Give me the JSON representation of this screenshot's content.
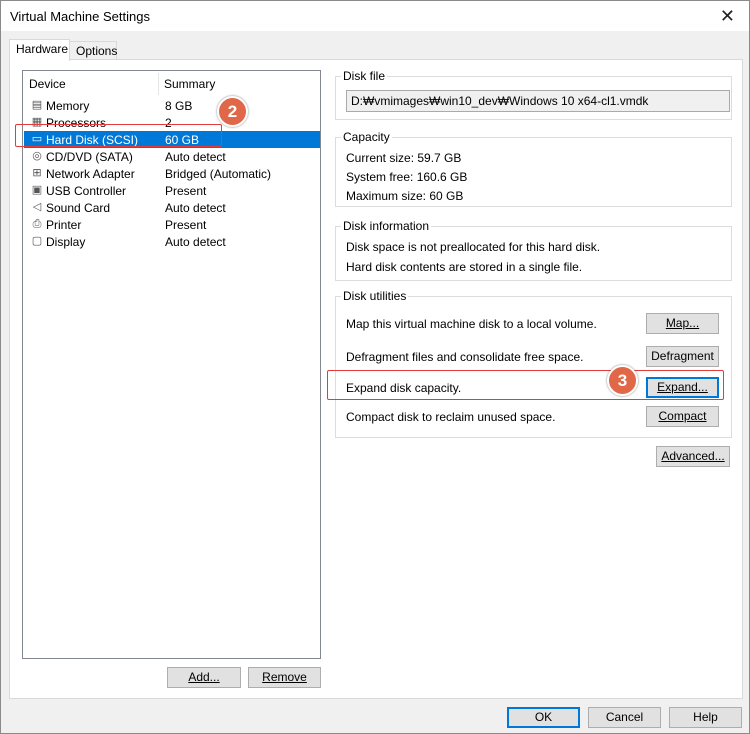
{
  "window": {
    "title": "Virtual Machine Settings",
    "close_glyph": "✕"
  },
  "tabs": [
    {
      "label": "Hardware",
      "active": true
    },
    {
      "label": "Options",
      "active": false
    }
  ],
  "device_list": {
    "col_device": "Device",
    "col_summary": "Summary",
    "rows": [
      {
        "name": "Memory",
        "summary": "8 GB",
        "icon": "memory-icon",
        "glyph": "▤"
      },
      {
        "name": "Processors",
        "summary": "2",
        "icon": "processor-icon",
        "glyph": "▦"
      },
      {
        "name": "Hard Disk (SCSI)",
        "summary": "60 GB",
        "icon": "hard-disk-icon",
        "glyph": "▭",
        "selected": true
      },
      {
        "name": "CD/DVD (SATA)",
        "summary": "Auto detect",
        "icon": "cd-dvd-icon",
        "glyph": "◎"
      },
      {
        "name": "Network Adapter",
        "summary": "Bridged (Automatic)",
        "icon": "network-adapter-icon",
        "glyph": "⊞"
      },
      {
        "name": "USB Controller",
        "summary": "Present",
        "icon": "usb-icon",
        "glyph": "▣"
      },
      {
        "name": "Sound Card",
        "summary": "Auto detect",
        "icon": "speaker-icon",
        "glyph": "◁"
      },
      {
        "name": "Printer",
        "summary": "Present",
        "icon": "printer-icon",
        "glyph": "⎙"
      },
      {
        "name": "Display",
        "summary": "Auto detect",
        "icon": "monitor-icon",
        "glyph": "▢"
      }
    ],
    "add_button": "Add...",
    "remove_button": "Remove"
  },
  "disk_file": {
    "title": "Disk file",
    "path": "D:₩vmimages₩win10_dev₩Windows 10 x64-cl1.vmdk"
  },
  "capacity": {
    "title": "Capacity",
    "current_size": "Current size:  59.7 GB",
    "system_free": "System free:  160.6 GB",
    "maximum_size": "Maximum size:  60 GB"
  },
  "disk_information": {
    "title": "Disk information",
    "line1": "Disk space is not preallocated for this hard disk.",
    "line2": "Hard disk contents are stored in a single file."
  },
  "disk_utilities": {
    "title": "Disk utilities",
    "map_text": "Map this virtual machine disk to a local volume.",
    "map_button": "Map...",
    "defrag_text": "Defragment files and consolidate free space.",
    "defrag_button": "Defragment",
    "expand_text": "Expand disk capacity.",
    "expand_button": "Expand...",
    "compact_text": "Compact disk to reclaim unused space.",
    "compact_button": "Compact"
  },
  "advanced_button": "Advanced...",
  "footer": {
    "ok": "OK",
    "cancel": "Cancel",
    "help": "Help"
  },
  "annotations": {
    "step2": "2",
    "step3": "3",
    "highlight_color": "#e03c3c",
    "badge_color": "#e06848"
  },
  "colors": {
    "selection": "#0078d7"
  }
}
